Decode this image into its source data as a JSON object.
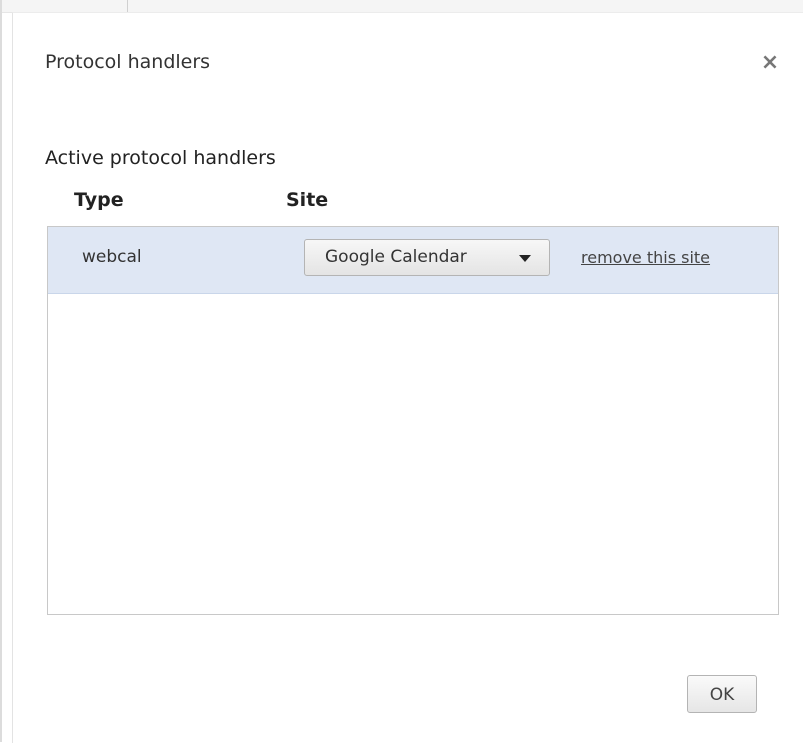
{
  "dialog": {
    "title": "Protocol handlers",
    "close_glyph": "×",
    "close_icon": "close-icon"
  },
  "section": {
    "heading": "Active protocol handlers"
  },
  "table": {
    "columns": [
      "Type",
      "Site"
    ],
    "rows": [
      {
        "type": "webcal",
        "site": "Google Calendar",
        "action": "remove this site"
      }
    ]
  },
  "footer": {
    "ok_label": "OK"
  },
  "colors": {
    "selected_row": "#dfe7f4",
    "text": "#333333"
  }
}
